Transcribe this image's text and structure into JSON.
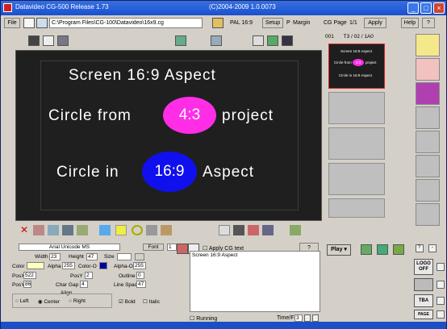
{
  "window": {
    "title": "Datavideo CG-500  Release 1.73",
    "copyright": "(C)2004-2009  1.0.0073",
    "min": "_",
    "max": "□",
    "close": "×"
  },
  "toolbar": {
    "file_label": "File",
    "path": "C:\\Program Files\\CG-100\\Datavideo\\16x9.cg",
    "format": "PAL 16:9",
    "setup_label": "Setup",
    "margin_check": "P",
    "margin_label": "Margin",
    "cg_page_label": "CG Page",
    "page_value": "1/1",
    "apply_label": "Apply",
    "help_label": "Help",
    "question": "?"
  },
  "canvas": {
    "line1": "Screen 16:9 Aspect",
    "line2_pre": "Circle from",
    "line2_circle": "4:3",
    "line2_post": "project",
    "line3_pre": "Circle in",
    "line3_circle": "16:9",
    "line3_post": "Aspect",
    "circle1_color": "#ff2ee6",
    "circle2_color": "#1010ee"
  },
  "mini_panel": {
    "header_id": "001",
    "header_info": "T3 / 02 / 1A0",
    "thumb_line1": "Screen 16:9 Aspect",
    "thumb_line2_pre": "Circle from",
    "thumb_line2_circle": "4:3",
    "thumb_line2_post": "project",
    "thumb_line3": "Circle in 16:9 Aspect"
  },
  "props": {
    "font_name": "Arial Unicode MS",
    "font_label": "Font",
    "font_num": "1",
    "width_label": "Width",
    "width_value": "23",
    "height_label": "Height",
    "height_value": "47",
    "size_label": "Size",
    "color_label": "Color",
    "alpha_label": "Alpha",
    "alpha_value": "255",
    "color0_label": "Color-O",
    "alpha0_label": "Alpha-O",
    "alpha0_value": "255",
    "posx_label": "PosX",
    "posx_value": "522",
    "posy_label": "PosY",
    "posy_value": "2",
    "outline_label": "Outline",
    "outline_value": "0",
    "posy2_label": "PosY",
    "posy2_value": "86",
    "chargap_label": "Char Gap",
    "chargap_value": "4",
    "linespace_label": "Line Space",
    "linespace_value": "47",
    "align_label": "Align",
    "left_label": "Left",
    "center_label": "Center",
    "right_label": "Right",
    "bold_label": "Bold",
    "italic_label": "Italic"
  },
  "text_panel": {
    "apply_check": "Apply CG text",
    "q": "?",
    "content": "Screen 16:9 Aspect",
    "running_label": "Running",
    "time_label": "Time/Fr",
    "time_value": "3"
  },
  "right_controls": {
    "play_label": "Play",
    "q_label": "?",
    "minus_label": "-",
    "logo_label": "LOGO OFF",
    "tba_label": "TBA",
    "page_label": "PAGE"
  }
}
